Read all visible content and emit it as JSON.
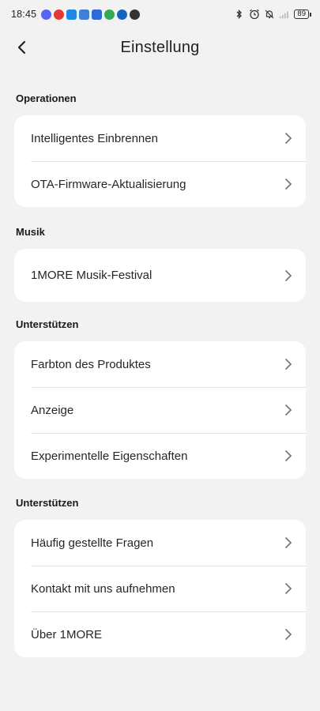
{
  "status_bar": {
    "time": "18:45",
    "battery": "89",
    "app_icons": [
      {
        "name": "discord-icon",
        "color": "#5865f2"
      },
      {
        "name": "app-red-icon",
        "color": "#e53935"
      },
      {
        "name": "app-blue-snowflake-icon",
        "color": "#1e88e5"
      },
      {
        "name": "app-mail-icon",
        "color": "#3f7fd8"
      },
      {
        "name": "app-triangle-icon",
        "color": "#2e6bd8"
      },
      {
        "name": "app-green-icon",
        "color": "#34a853"
      },
      {
        "name": "app-p-icon",
        "color": "#1565c0"
      },
      {
        "name": "app-dark-icon",
        "color": "#333333"
      }
    ]
  },
  "header": {
    "title": "Einstellung"
  },
  "sections": [
    {
      "title": "Operationen",
      "items": [
        {
          "label": "Intelligentes Einbrennen"
        },
        {
          "label": "OTA-Firmware-Aktualisierung"
        }
      ]
    },
    {
      "title": "Musik",
      "items": [
        {
          "label": "1MORE Musik-Festival"
        }
      ]
    },
    {
      "title": "Unterstützen",
      "items": [
        {
          "label": "Farbton des Produktes"
        },
        {
          "label": "Anzeige"
        },
        {
          "label": "Experimentelle Eigenschaften"
        }
      ]
    },
    {
      "title": "Unterstützen",
      "items": [
        {
          "label": "Häufig gestellte Fragen"
        },
        {
          "label": "Kontakt mit uns aufnehmen"
        },
        {
          "label": "Über 1MORE"
        }
      ]
    }
  ]
}
